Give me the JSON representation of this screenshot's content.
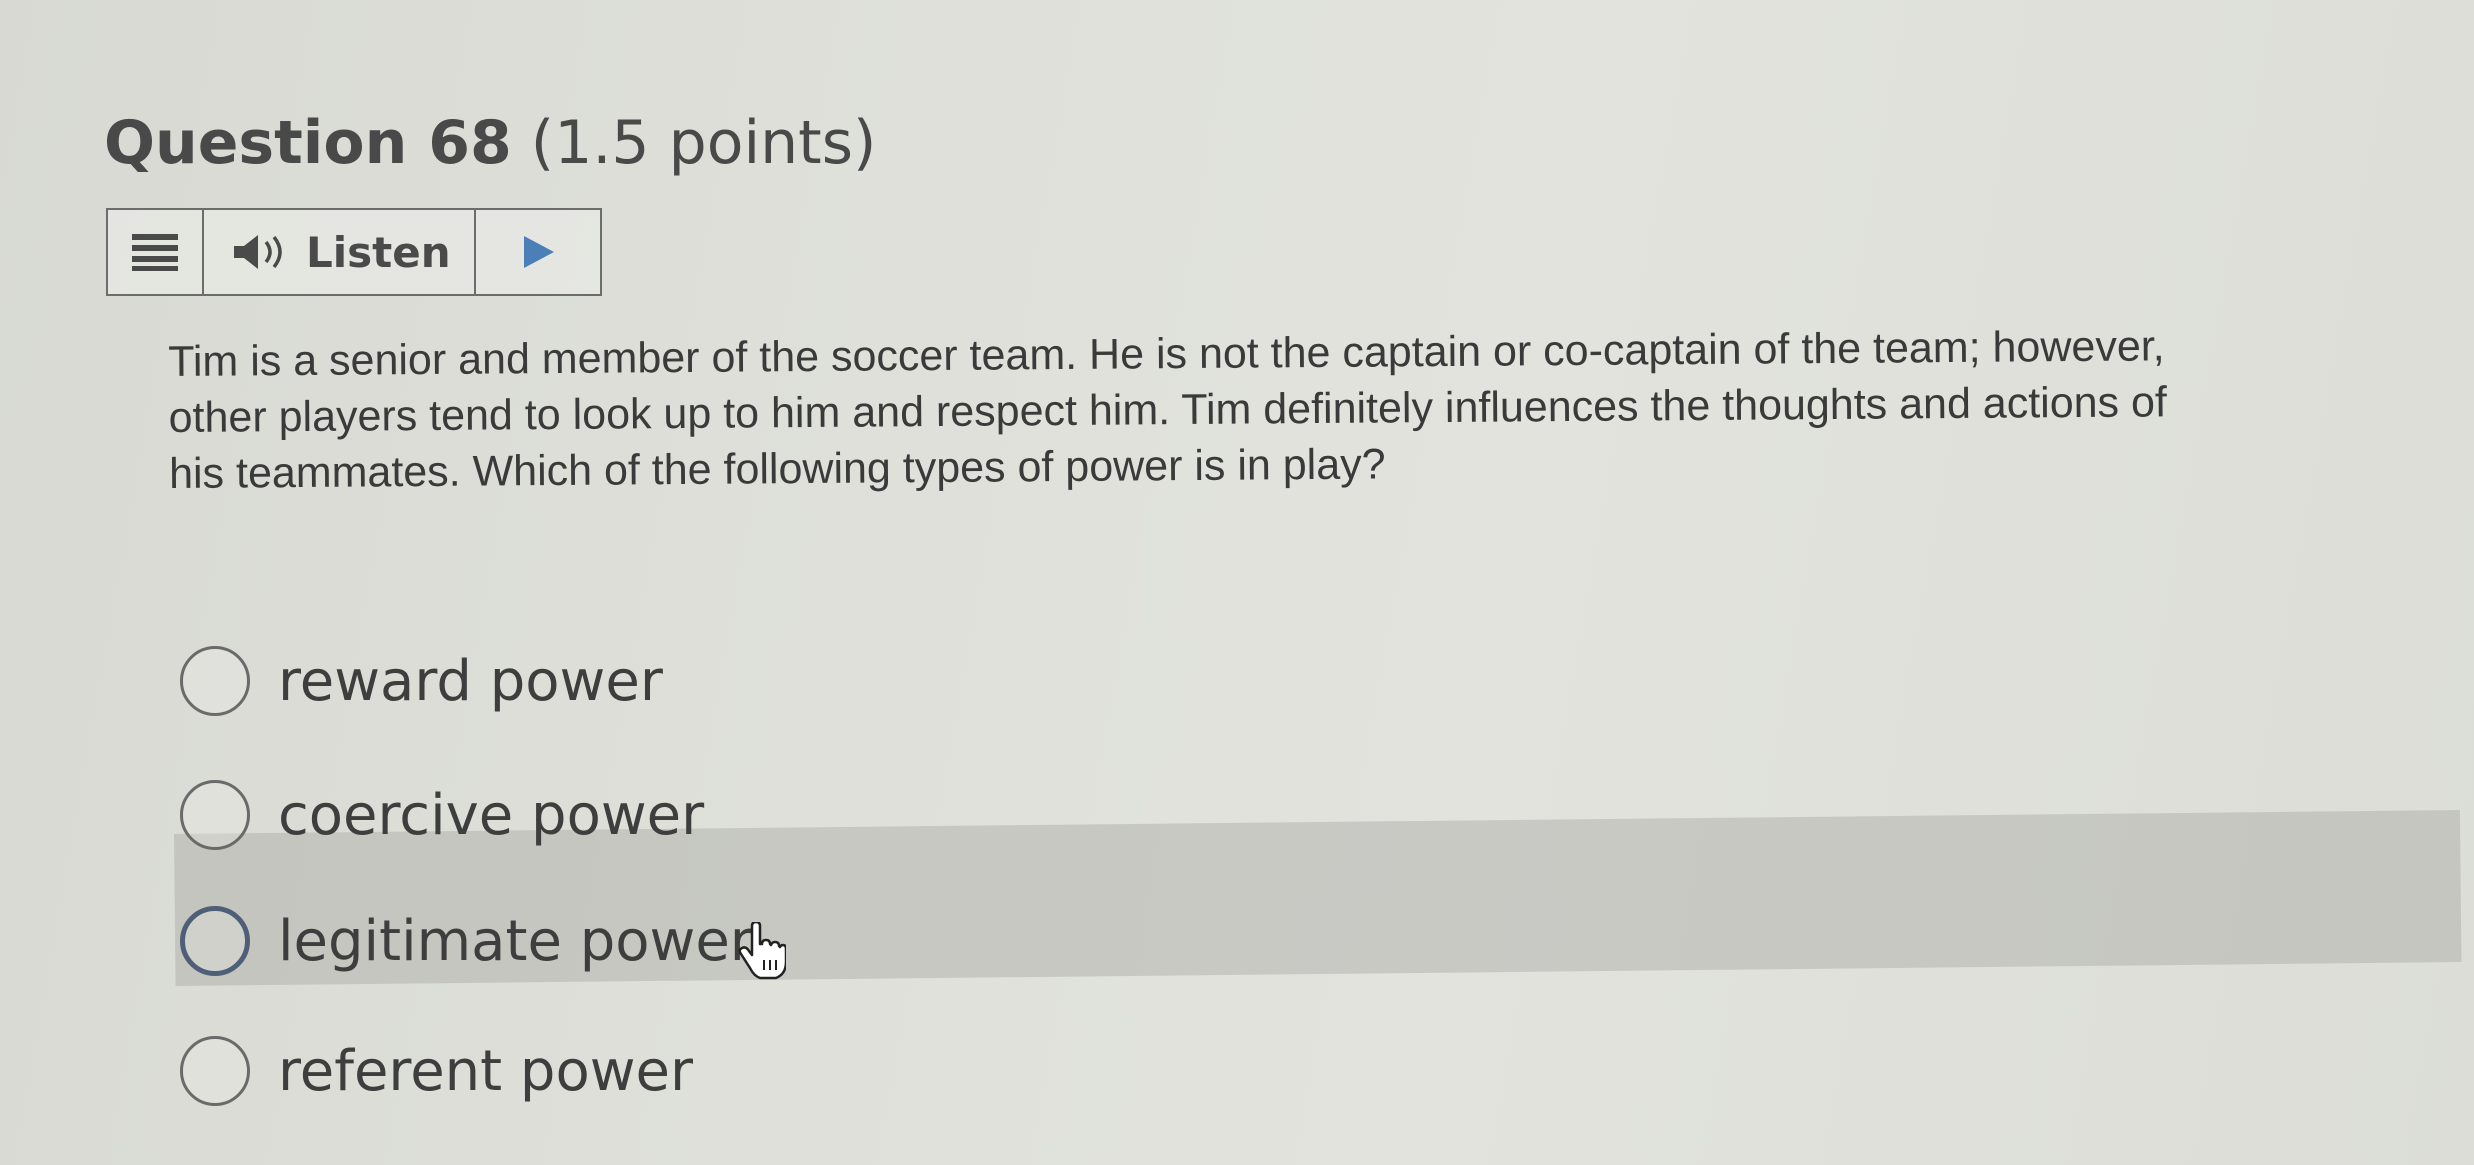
{
  "question": {
    "number_label": "Question 68",
    "points_label": "(1.5 points)",
    "text_lines": [
      "Tim is a senior and member of the soccer team.  He is not the captain or co-captain of the team; however,",
      "other players tend to look up to him and respect him. Tim definitely influences the thoughts and actions of",
      "his teammates. Which of the following types of power is in play?"
    ]
  },
  "listen_bar": {
    "menu_icon": "menu-icon",
    "speaker_icon": "speaker-icon",
    "listen_label": "Listen",
    "play_icon": "play-icon"
  },
  "options": [
    {
      "label": "reward power",
      "selected": false,
      "hovered": false
    },
    {
      "label": "coercive power",
      "selected": false,
      "hovered": false
    },
    {
      "label": "legitimate power",
      "selected": false,
      "hovered": true
    },
    {
      "label": "referent power",
      "selected": false,
      "hovered": false
    }
  ],
  "cursor_icon": "hand-pointer-icon",
  "colors": {
    "play_accent": "#4a7fb8",
    "hover_band": "#a0a09a",
    "radio_hover_border": "#4f5f78"
  }
}
